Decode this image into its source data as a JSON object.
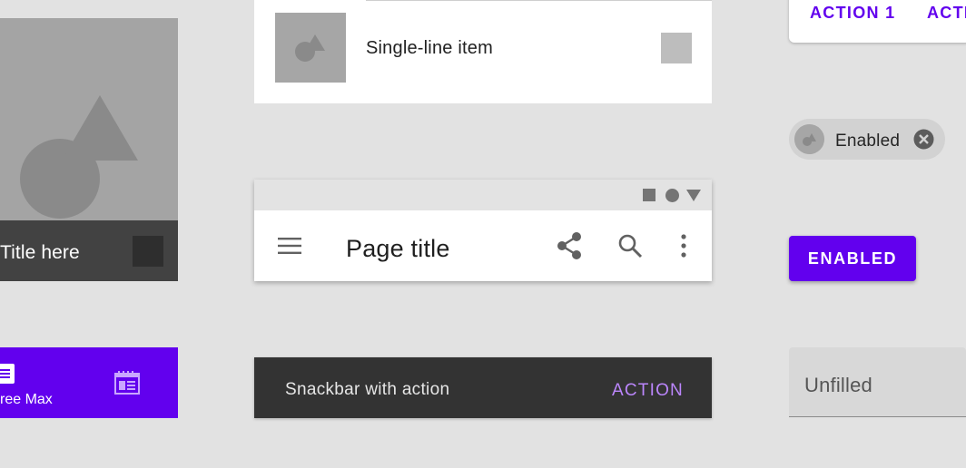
{
  "image_card": {
    "title": "Title here"
  },
  "bottom_nav": {
    "items": [
      {
        "label": "ree Max",
        "icon": "article-icon"
      },
      {
        "label": "",
        "icon": "calendar-view-icon"
      }
    ],
    "color": "#6200ee"
  },
  "list_item": {
    "label": "Single-line item"
  },
  "app_bar": {
    "title": "Page title",
    "icons": [
      "menu-icon",
      "share-icon",
      "search-icon",
      "more-vert-icon"
    ]
  },
  "snackbar": {
    "message": "Snackbar with action",
    "action": "ACTION",
    "action_color": "#bb86fc"
  },
  "dialog": {
    "actions": [
      "ACTION 1",
      "ACTI"
    ]
  },
  "chip": {
    "label": "Enabled"
  },
  "button": {
    "label": "ENABLED",
    "color": "#6200ee"
  },
  "text_field": {
    "placeholder": "Unfilled"
  }
}
